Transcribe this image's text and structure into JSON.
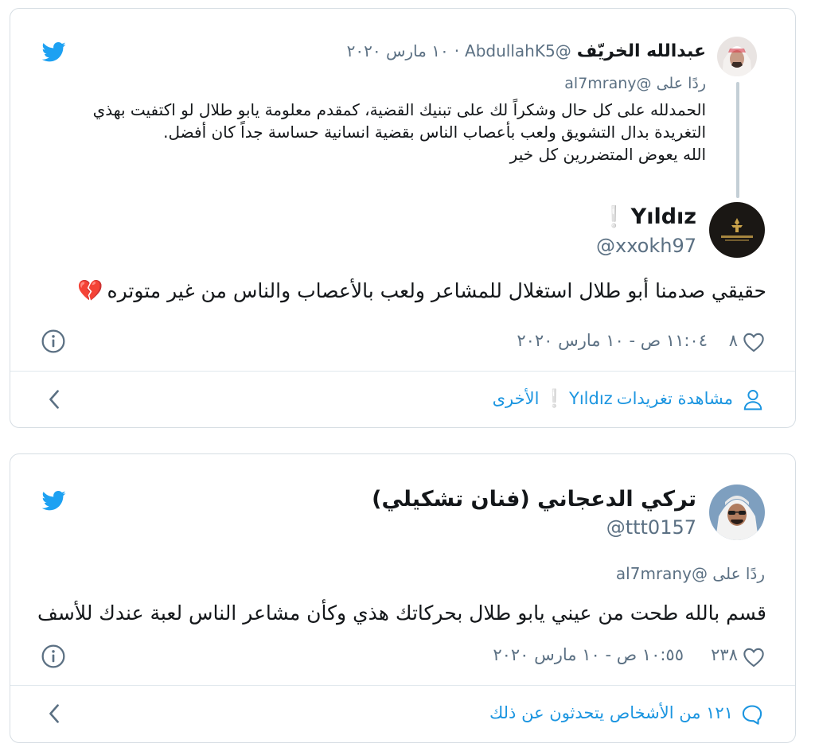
{
  "card1": {
    "parent": {
      "name": "عبدالله الخريّف",
      "handle": "@AbdullahK5",
      "date": "١٠ مارس ٢٠٢٠",
      "separator": "·",
      "reply_prefix": "ردًا على",
      "reply_handle": "@al7mrany",
      "lines": [
        "الحمدلله على كل حال وشكراً لك على تبنيك القضية، كمقدم معلومة يابو طلال لو اكتفيت بهذي",
        "التغريدة بدال التشويق ولعب بأعصاب الناس بقضية انسانية حساسة جداً كان أفضل.",
        "الله يعوض المتضررين كل خير"
      ]
    },
    "main": {
      "name": "Yıldız",
      "name_emoji": "❕",
      "handle": "@xxokh97",
      "text": "حقيقي صدمنا أبو طلال استغلال للمشاعر ولعب بالأعصاب والناس من غير متوتره",
      "text_emoji": "💔",
      "likes": "٨",
      "timestamp": "١١:٠٤ ص - ١٠ مارس ٢٠٢٠"
    },
    "footer": {
      "view_prefix": "مشاهدة تغريدات",
      "view_name": "Yıldız",
      "view_emoji": "❕",
      "view_suffix": "الأخرى"
    }
  },
  "card2": {
    "name": "تركي الدعجاني (فنان تشكيلي)",
    "handle": "@ttt0157",
    "reply_prefix": "ردًا على",
    "reply_handle": "@al7mrany",
    "text": "قسم بالله طحت من عيني يابو طلال بحركاتك هذي وكأن مشاعر الناس لعبة عندك للأسف",
    "likes": "٢٣٨",
    "timestamp": "١٠:٥٥ ص - ١٠ مارس ٢٠٢٠",
    "footer": "١٢١ من الأشخاص يتحدثون عن ذلك"
  },
  "colors": {
    "twitter_blue": "#1da1f2",
    "link_blue": "#1b95e0",
    "muted": "#5b7083",
    "border": "#d6dde3",
    "heart_red": "#e0245e"
  },
  "icons": [
    "twitter-bird-icon",
    "info-icon",
    "heart-icon",
    "chevron-left-icon",
    "user-icon",
    "speech-bubble-icon",
    "broken-heart-emoji",
    "exclamation-emoji"
  ]
}
